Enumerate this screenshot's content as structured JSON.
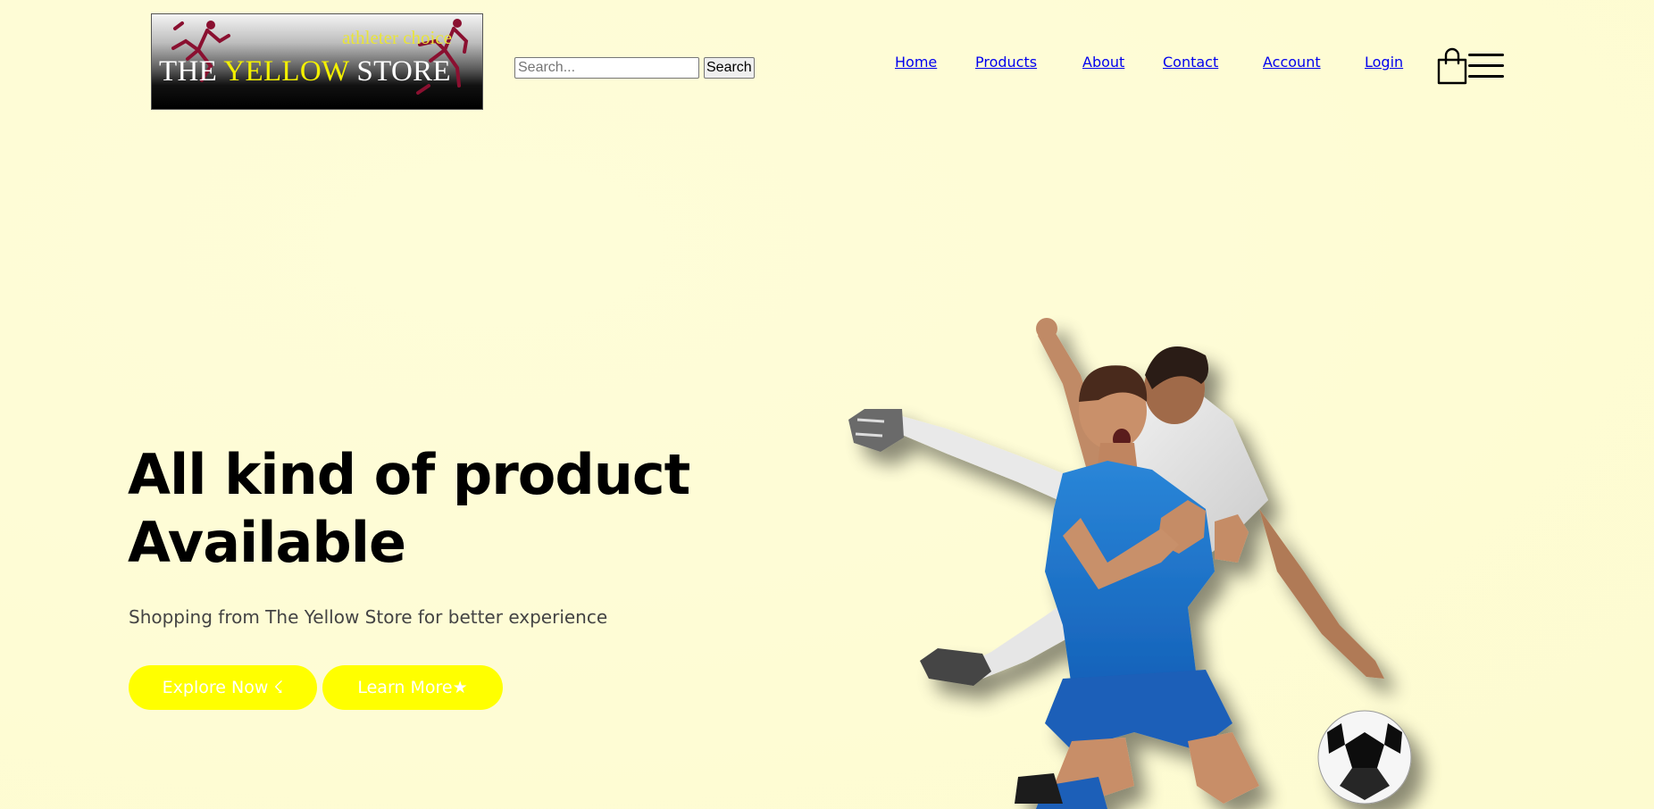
{
  "header": {
    "logo": {
      "tagline": "athleter choice",
      "name_part1": "THE ",
      "name_part2": "YELLOW",
      "name_part3": " STORE"
    },
    "search": {
      "placeholder": "Search...",
      "button_label": "Search"
    },
    "nav": {
      "items": [
        {
          "label": "Home"
        },
        {
          "label": "Products"
        },
        {
          "label": "About"
        },
        {
          "label": "Contact"
        },
        {
          "label": "Account"
        },
        {
          "label": "Login"
        }
      ]
    },
    "icons": {
      "cart": "shopping-bag-icon",
      "menu": "hamburger-menu-icon"
    }
  },
  "hero": {
    "title_line1": "All kind of product",
    "title_line2": "Available",
    "subtitle": "Shopping from The Yellow Store for better experience",
    "buttons": {
      "explore_label": "Explore Now ☇",
      "learn_label": "Learn More★"
    },
    "image": "soccer-players-image"
  },
  "colors": {
    "background": "#fefcd6",
    "accent": "#ffff00",
    "button_text": "#ffffff",
    "title": "#000000",
    "nav_text": "#555555",
    "logo_yellow": "#f3f000"
  }
}
